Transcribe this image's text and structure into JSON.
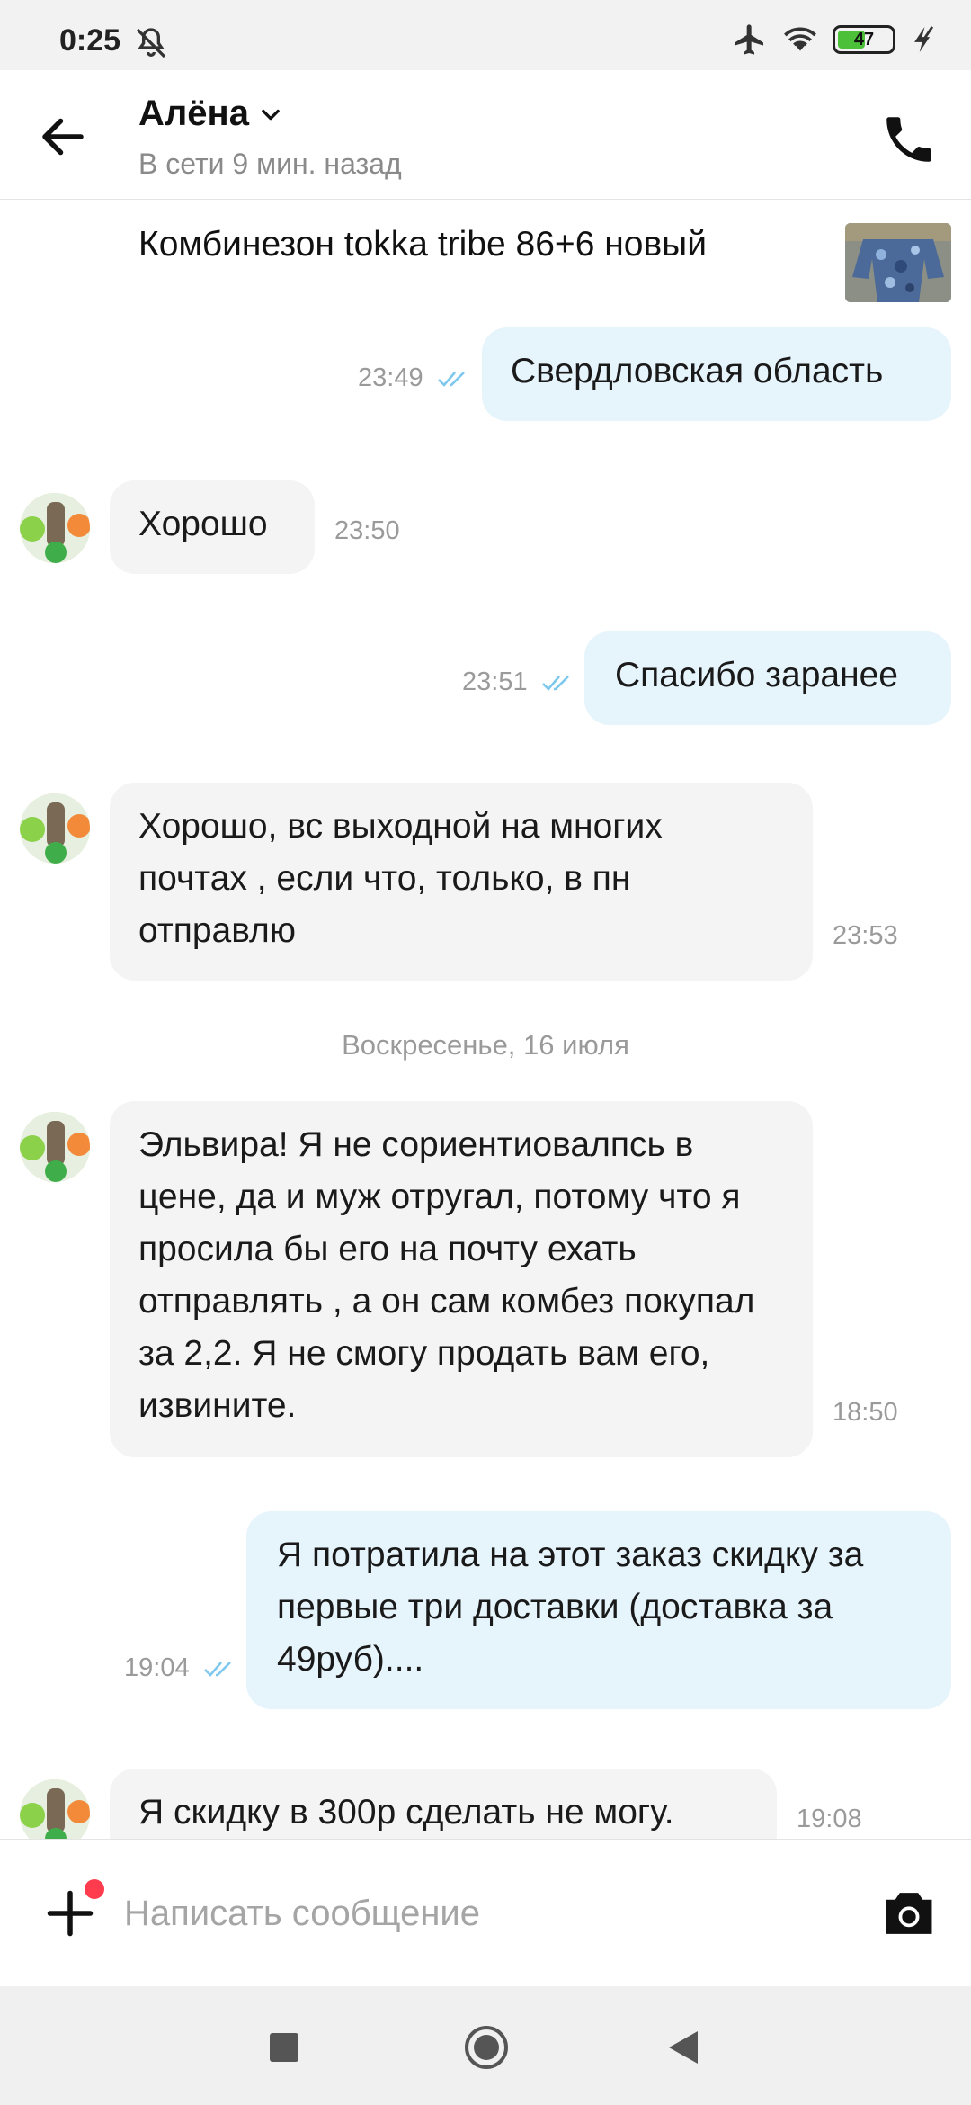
{
  "status_bar": {
    "time": "0:25",
    "battery": "47",
    "battery_level": 0.47,
    "icons": [
      "mute-icon",
      "airplane-icon",
      "wifi-icon",
      "battery-icon",
      "charging-icon"
    ]
  },
  "header": {
    "contact_name": "Алёна",
    "contact_status": "В сети 9 мин. назад",
    "icons": [
      "back-arrow-icon",
      "chevron-down-icon",
      "phone-icon"
    ]
  },
  "product": {
    "title": "Комбинезон tokka tribe 86+6 новый"
  },
  "messages": [
    {
      "direction": "out",
      "text": "Свердловская область",
      "time": "23:49",
      "read": true
    },
    {
      "direction": "in",
      "text": "Хорошо",
      "time": "23:50"
    },
    {
      "direction": "out",
      "text": "Спасибо заранее",
      "time": "23:51",
      "read": true
    },
    {
      "direction": "in",
      "text": "Хорошо, вс выходной на многих почтах , если что, только, в пн отправлю",
      "time": "23:53"
    },
    {
      "direction": "in",
      "text": "Эльвира! Я не сориентиовалпсь в цене, да и муж отругал, потому что я просила бы его  на почту ехать отправлять , а он сам комбез покупал за 2,2. Я не смогу продать вам его, извините.",
      "time": "18:50"
    },
    {
      "direction": "out",
      "text": "Я потратила на этот заказ скидку за первые три доставки (доставка за 49руб)....",
      "time": "19:04",
      "read": true
    },
    {
      "direction": "in",
      "text": "Я скидку в 300р сделать не могу.",
      "time": "19:08"
    }
  ],
  "date_separator": "Воскресенье, 16 июля",
  "composer": {
    "placeholder": "Написать сообщение",
    "icons": [
      "plus-icon",
      "camera-icon"
    ]
  },
  "colors": {
    "outgoing_bubble": "#e6f4fc",
    "incoming_bubble": "#f4f4f4",
    "read_ticks": "#7ec8ee",
    "notification_dot": "#ff3b4e"
  }
}
